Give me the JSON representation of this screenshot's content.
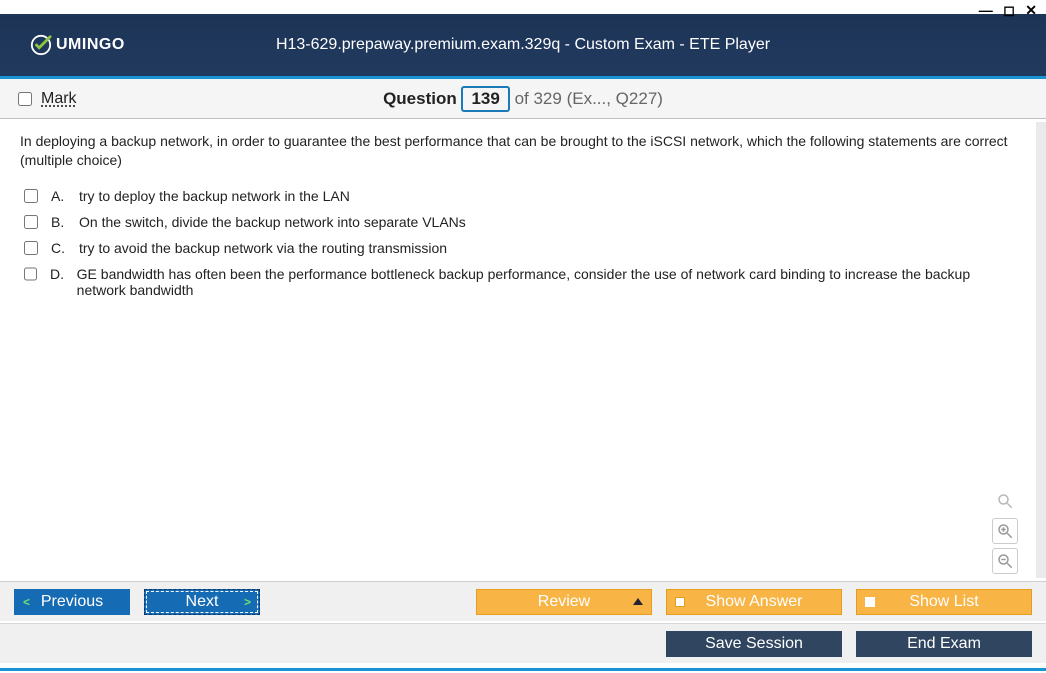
{
  "brand": "UMINGO",
  "title": "H13-629.prepaway.premium.exam.329q - Custom Exam - ETE Player",
  "qhead": {
    "mark_label": "Mark",
    "question_word": "Question",
    "current": "139",
    "tail": "of 329 (Ex..., Q227)"
  },
  "question_text": "In deploying a backup network, in order to guarantee the best performance that can be brought to the iSCSI network, which the following statements are correct (multiple choice)",
  "options": [
    {
      "letter": "A.",
      "text": "try to deploy the backup network in the LAN"
    },
    {
      "letter": "B.",
      "text": "On the switch, divide the backup network into separate VLANs"
    },
    {
      "letter": "C.",
      "text": "try to avoid the backup network via the routing transmission"
    },
    {
      "letter": "D.",
      "text": "GE bandwidth has often been the performance bottleneck backup performance, consider the use of network card binding to increase the backup network bandwidth"
    }
  ],
  "buttons": {
    "previous": "Previous",
    "next": "Next",
    "review": "Review",
    "show_answer": "Show Answer",
    "show_list": "Show List",
    "save_session": "Save Session",
    "end_exam": "End Exam"
  }
}
